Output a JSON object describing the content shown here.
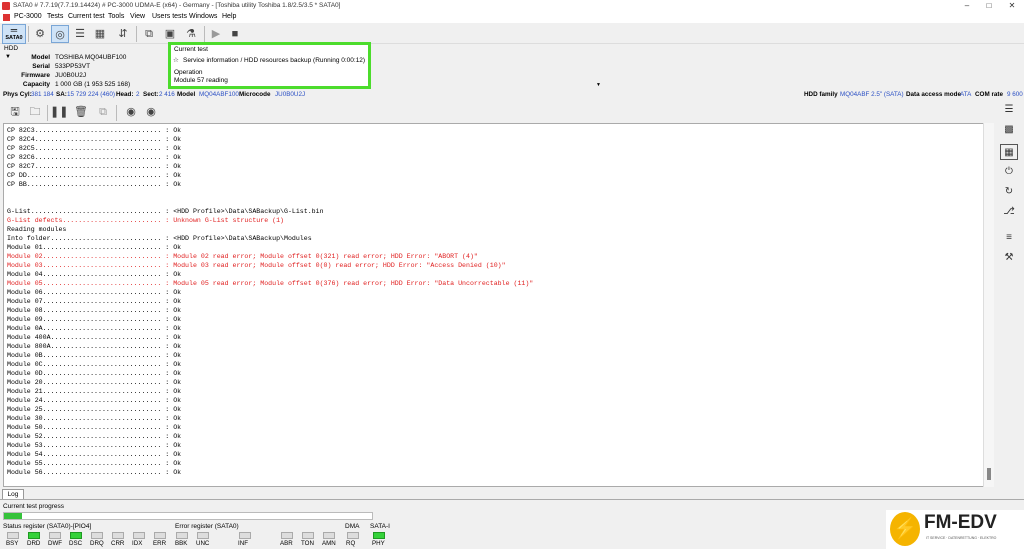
{
  "window": {
    "title": "SATA0 # 7.7.19(7.7.19.14424) # PC-3000 UDMA-E (x64) - Germany - [Toshiba utility Toshiba 1.8/2.5/3.5 * SATA0]"
  },
  "menu": [
    "PC-3000",
    "Tests",
    "Current test",
    "Tools",
    "View",
    "Users tests",
    "Windows",
    "Help"
  ],
  "toolbar": {
    "sata_label": "SATA0"
  },
  "hdd": {
    "section": "HDD",
    "model_label": "Model",
    "model": "TOSHIBA MQ04UBF100",
    "serial_label": "Serial",
    "serial": "533PP53VT",
    "firmware_label": "Firmware",
    "firmware": "JU0B0U2J",
    "capacity_label": "Capacity",
    "capacity": "1 000 GB (1 953 525 168)"
  },
  "current_test": {
    "header": "Current test",
    "value": "Service information / HDD resources backup (Running 0:00:12)",
    "op_header": "Operation",
    "op_value": "Module 57 reading"
  },
  "infobar": {
    "phys_cyl_label": "Phys Cyl:",
    "phys_cyl": "381 184",
    "sa_label": "SA:",
    "sa": "15 729 224 (460)",
    "head_label": "Head:",
    "head": "2",
    "sect_label": "Sect:",
    "sect": "2 416",
    "model_label": "Model",
    "model": "MQ04ABF100",
    "microcode_label": "Microcode",
    "microcode": "JU0B0U2J",
    "family_label": "HDD family",
    "family": "MQ04ABF 2.5\" (SATA)",
    "dam_label": "Data access mode",
    "dam": "ATA",
    "com_label": "COM rate",
    "com": "9 600"
  },
  "log_lines": [
    {
      "t": "CP 82C3................................ : Ok",
      "e": false
    },
    {
      "t": "CP 82C4................................ : Ok",
      "e": false
    },
    {
      "t": "CP 82C5................................ : Ok",
      "e": false
    },
    {
      "t": "CP 82C6................................ : Ok",
      "e": false
    },
    {
      "t": "CP 82C7................................ : Ok",
      "e": false
    },
    {
      "t": "CP DD.................................. : Ok",
      "e": false
    },
    {
      "t": "CP BB.................................. : Ok",
      "e": false
    },
    {
      "t": "",
      "e": false
    },
    {
      "t": "",
      "e": false
    },
    {
      "t": "G-List................................. : <HDD Profile>\\Data\\SABackup\\G-List.bin",
      "e": false
    },
    {
      "t": "G-List defects......................... : Unknown G-List structure (1)",
      "e": true
    },
    {
      "t": "Reading modules",
      "e": false
    },
    {
      "t": "Into folder............................ : <HDD Profile>\\Data\\SABackup\\Modules",
      "e": false
    },
    {
      "t": "Module 01.............................. : Ok",
      "e": false
    },
    {
      "t": "Module 02.............................. : Module 02 read error; Module offset 0(321) read error; HDD Error: \"ABORT (4)\"",
      "e": true
    },
    {
      "t": "Module 03.............................. : Module 03 read error; Module offset 0(0) read error; HDD Error: \"Access Denied (10)\"",
      "e": true
    },
    {
      "t": "Module 04.............................. : Ok",
      "e": false
    },
    {
      "t": "Module 05.............................. : Module 05 read error; Module offset 0(376) read error; HDD Error: \"Data Uncorrectable (11)\"",
      "e": true
    },
    {
      "t": "Module 06.............................. : Ok",
      "e": false
    },
    {
      "t": "Module 07.............................. : Ok",
      "e": false
    },
    {
      "t": "Module 08.............................. : Ok",
      "e": false
    },
    {
      "t": "Module 09.............................. : Ok",
      "e": false
    },
    {
      "t": "Module 0A.............................. : Ok",
      "e": false
    },
    {
      "t": "Module 400A............................ : Ok",
      "e": false
    },
    {
      "t": "Module 800A............................ : Ok",
      "e": false
    },
    {
      "t": "Module 0B.............................. : Ok",
      "e": false
    },
    {
      "t": "Module 0C.............................. : Ok",
      "e": false
    },
    {
      "t": "Module 0D.............................. : Ok",
      "e": false
    },
    {
      "t": "Module 20.............................. : Ok",
      "e": false
    },
    {
      "t": "Module 21.............................. : Ok",
      "e": false
    },
    {
      "t": "Module 24.............................. : Ok",
      "e": false
    },
    {
      "t": "Module 25.............................. : Ok",
      "e": false
    },
    {
      "t": "Module 30.............................. : Ok",
      "e": false
    },
    {
      "t": "Module 50.............................. : Ok",
      "e": false
    },
    {
      "t": "Module 52.............................. : Ok",
      "e": false
    },
    {
      "t": "Module 53.............................. : Ok",
      "e": false
    },
    {
      "t": "Module 54.............................. : Ok",
      "e": false
    },
    {
      "t": "Module 55.............................. : Ok",
      "e": false
    },
    {
      "t": "Module 56.............................. : Ok",
      "e": false
    }
  ],
  "log_tab": "Log",
  "progress": {
    "label": "Current test progress",
    "fraction": 0.05
  },
  "status_register": {
    "title": "Status register (SATA0)-[PIO4]",
    "flags": [
      {
        "n": "BSY",
        "on": false
      },
      {
        "n": "DRD",
        "on": true
      },
      {
        "n": "DWF",
        "on": false
      },
      {
        "n": "DSC",
        "on": true
      },
      {
        "n": "DRQ",
        "on": false
      },
      {
        "n": "CRR",
        "on": false
      },
      {
        "n": "IDX",
        "on": false
      },
      {
        "n": "ERR",
        "on": false
      }
    ]
  },
  "error_register": {
    "title": "Error register (SATA0)",
    "flags": [
      {
        "n": "BBK",
        "on": false
      },
      {
        "n": "UNC",
        "on": false
      },
      {
        "n": "INF",
        "on": false
      },
      {
        "n": "ABR",
        "on": false
      },
      {
        "n": "TON",
        "on": false
      },
      {
        "n": "AMN",
        "on": false
      }
    ]
  },
  "dma": {
    "title": "DMA",
    "flag": "RQ"
  },
  "sata_group": {
    "title": "SATA-I",
    "flag": "PHY"
  },
  "logo": {
    "brand": "FM-EDV",
    "tagline": "IT SERVICE · DATENRETTUNG · ELEKTRO"
  },
  "colors": {
    "accent_green": "#4cdc2c",
    "error_red": "#e02020",
    "value_blue": "#2a4fc4"
  }
}
